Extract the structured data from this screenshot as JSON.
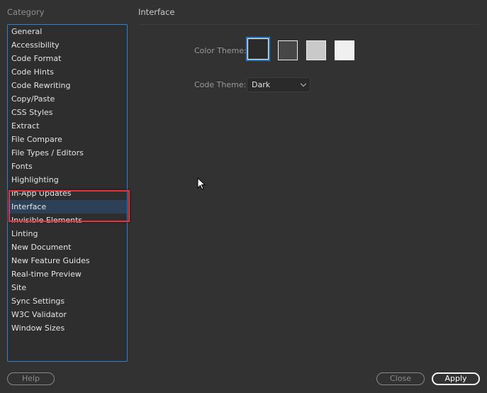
{
  "sidebar": {
    "title": "Category",
    "selected": "Interface",
    "items": [
      "General",
      "Accessibility",
      "Code Format",
      "Code Hints",
      "Code Rewriting",
      "Copy/Paste",
      "CSS Styles",
      "Extract",
      "File Compare",
      "File Types / Editors",
      "Fonts",
      "Highlighting",
      "In-App Updates",
      "Interface",
      "Invisible Elements",
      "Linting",
      "New Document",
      "New Feature Guides",
      "Real-time Preview",
      "Site",
      "Sync Settings",
      "W3C Validator",
      "Window Sizes"
    ]
  },
  "main": {
    "title": "Interface",
    "color_theme_label": "Color Theme:",
    "color_themes": [
      "#2b2b2b",
      "#474747",
      "#c9c9c9",
      "#f0f0f0"
    ],
    "selected_theme": 0,
    "code_theme_label": "Code Theme:",
    "code_theme_value": "Dark"
  },
  "footer": {
    "help": "Help",
    "close": "Close",
    "apply": "Apply"
  },
  "colors": {
    "accent": "#2d7fd1",
    "highlight_box": "#e8323c"
  }
}
